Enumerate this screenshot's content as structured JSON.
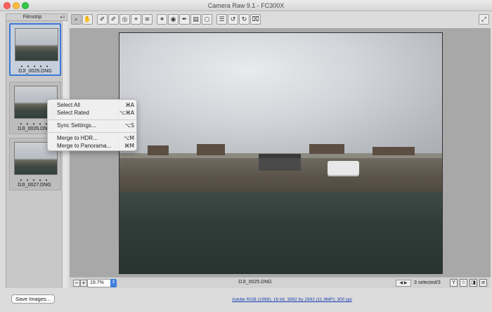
{
  "window": {
    "title": "Camera Raw 9.1  -  FC300X"
  },
  "filmstrip": {
    "title": "Filmstrip",
    "menu_glyph": "▸≡",
    "items": [
      {
        "name": "DJI_0025.DNG",
        "rating": "• • • • •",
        "selected": true
      },
      {
        "name": "DJI_0026.DNG",
        "rating": "• • • • •",
        "selected": false
      },
      {
        "name": "DJI_0027.DNG",
        "rating": "• • • • •",
        "selected": false
      }
    ]
  },
  "toolbar": {
    "tools": [
      {
        "icon": "zoom-icon",
        "glyph": "⌕"
      },
      {
        "icon": "hand-icon",
        "glyph": "✋"
      },
      {
        "icon": "white-balance-icon",
        "glyph": "✐"
      },
      {
        "icon": "color-sampler-icon",
        "glyph": "✐"
      },
      {
        "icon": "targeted-adjustment-icon",
        "glyph": "◎"
      },
      {
        "icon": "crop-icon",
        "glyph": "⌖"
      },
      {
        "icon": "straighten-icon",
        "glyph": "≡"
      },
      {
        "icon": "spot-removal-icon",
        "glyph": "✶"
      },
      {
        "icon": "red-eye-icon",
        "glyph": "◉"
      },
      {
        "icon": "adjustment-brush-icon",
        "glyph": "✒"
      },
      {
        "icon": "graduated-filter-icon",
        "glyph": "▤"
      },
      {
        "icon": "radial-filter-icon",
        "glyph": "○"
      },
      {
        "icon": "preferences-icon",
        "glyph": "☰"
      },
      {
        "icon": "rotate-ccw-icon",
        "glyph": "↺"
      },
      {
        "icon": "rotate-cw-icon",
        "glyph": "↻"
      },
      {
        "icon": "trash-icon",
        "glyph": "⌧"
      }
    ],
    "fullscreen_glyph": "⤢"
  },
  "context_menu": {
    "items": [
      {
        "label": "Select All",
        "shortcut": "⌘A"
      },
      {
        "label": "Select Rated",
        "shortcut": "⌥⌘A"
      },
      {
        "label": "Sync Settings...",
        "shortcut": "⌥S"
      },
      {
        "label": "Merge to HDR...",
        "shortcut": "⌥M"
      },
      {
        "label": "Merge to Panorama...",
        "shortcut": "⌘M"
      }
    ]
  },
  "preview": {
    "filename": "DJI_0025.DNG"
  },
  "bottombar": {
    "zoom_out": "−",
    "zoom_in": "+",
    "zoom": "19.7%",
    "zoom_caret": "⇕",
    "nav": "◀ ▶",
    "selection_status": "3 selected/3",
    "icons": [
      {
        "name": "filter-icon",
        "glyph": "Y"
      },
      {
        "name": "rating-icon",
        "glyph": "☆"
      },
      {
        "name": "before-after-icon",
        "glyph": "◨"
      },
      {
        "name": "view-settings-icon",
        "glyph": "≡"
      }
    ]
  },
  "footer": {
    "save_label": "Save Images...",
    "workflow_link": "Adobe RGB (1998); 16 bit; 3992 by 2992 (11.9MP); 300 ppi"
  }
}
